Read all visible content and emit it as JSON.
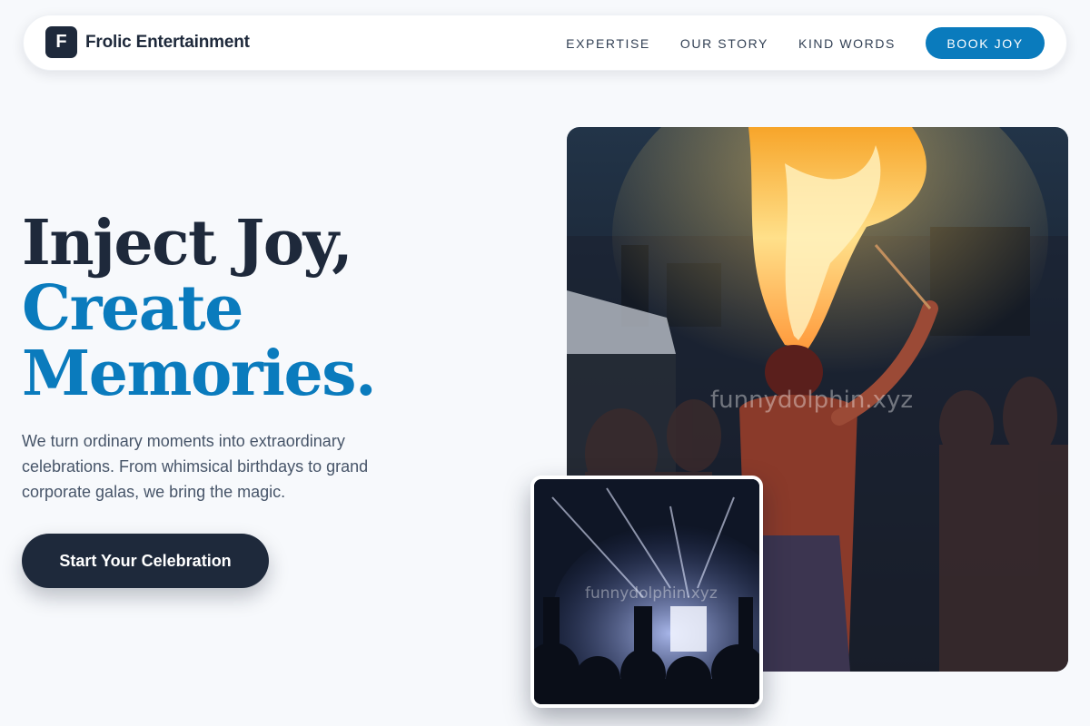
{
  "brand": {
    "mark": "F",
    "name": "Frolic Entertainment"
  },
  "nav": {
    "links": [
      "EXPERTISE",
      "OUR STORY",
      "KIND WORDS"
    ],
    "cta": "BOOK JOY"
  },
  "hero": {
    "title_lines": [
      "Inject Joy,",
      "Create",
      "Memories."
    ],
    "text_lines": [
      "We turn ordinary moments into extraordinary",
      "celebrations. From whimsical birthdays to grand",
      "corporate galas, we bring the magic."
    ],
    "cta": "Start Your Celebration"
  },
  "images": {
    "main_watermark": "funnydolphin.xyz",
    "inset_watermark": "funnydolphin.xyz"
  },
  "colors": {
    "accent": "#0a7bbd",
    "dark": "#1e293b",
    "background": "#f7f9fc"
  }
}
